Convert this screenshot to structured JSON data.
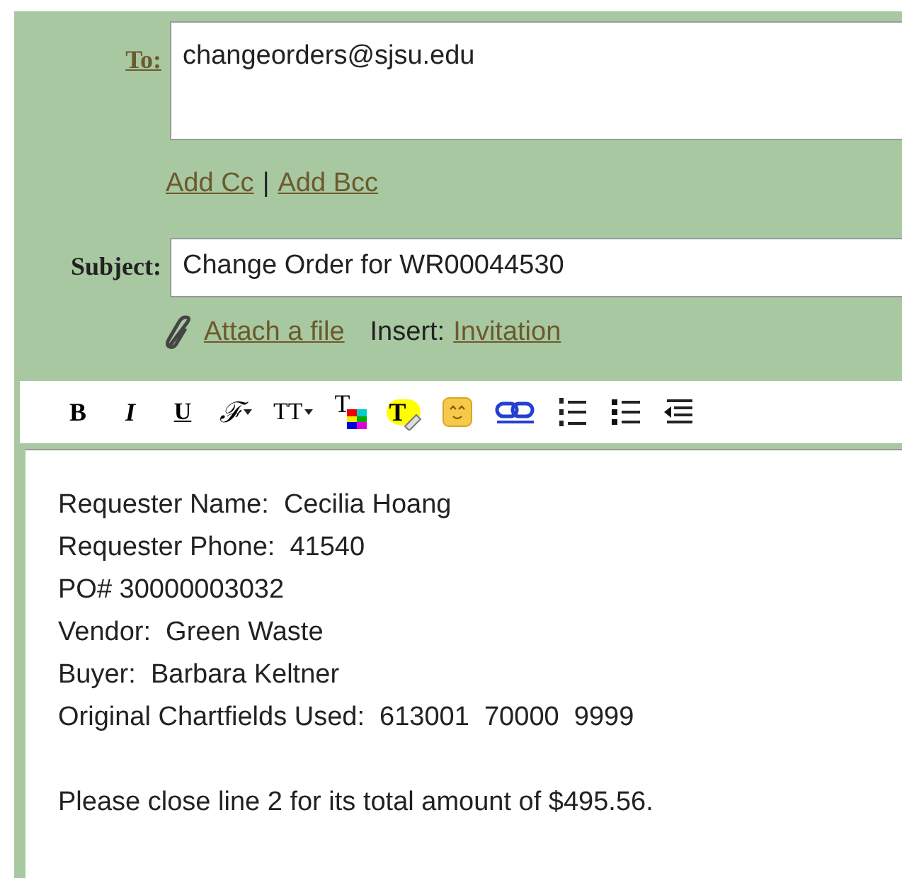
{
  "to": {
    "label": "To:",
    "value": "changeorders@sjsu.edu"
  },
  "cc_links": [
    {
      "label": "Add Cc"
    },
    {
      "label": "Add Bcc"
    }
  ],
  "cc_separator": "|",
  "subject": {
    "label": "Subject:",
    "value": "Change Order for WR00044530"
  },
  "attach": {
    "label": "Attach a file"
  },
  "insert": {
    "label": "Insert:",
    "link": "Invitation"
  },
  "toolbar": [
    {
      "kind": "bold",
      "label": "B"
    },
    {
      "kind": "italic",
      "label": "I"
    },
    {
      "kind": "underline",
      "label": "U"
    },
    {
      "kind": "font",
      "label": "ℱ"
    },
    {
      "kind": "size",
      "label": "TT"
    },
    {
      "kind": "textcolor",
      "label": "T"
    },
    {
      "kind": "highlight",
      "label": "T"
    },
    {
      "kind": "emoji"
    },
    {
      "kind": "link"
    },
    {
      "kind": "numbered"
    },
    {
      "kind": "bulleted"
    },
    {
      "kind": "indent"
    }
  ],
  "body": [
    [
      "Requester Name:  Cecilia Hoang",
      "Requester Phone:  41540",
      "PO# 30000003032",
      "Vendor:  Green Waste",
      "Buyer:  Barbara Keltner",
      "Original Chartfields Used:  613001  70000  9999"
    ],
    [
      "Please close line 2 for its total amount of $495.56."
    ]
  ]
}
